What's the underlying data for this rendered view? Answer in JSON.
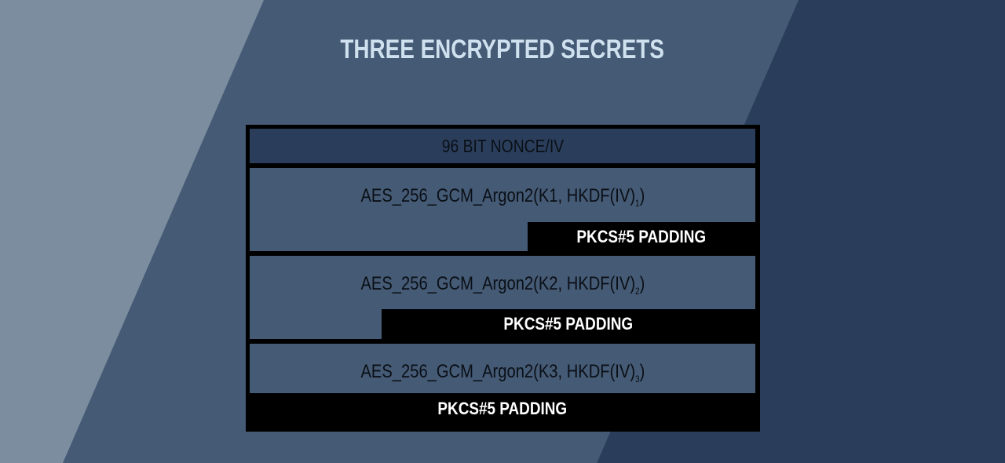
{
  "title": "THREE ENCRYPTED SECRETS",
  "nonce": {
    "label": "96 BIT NONCE/IV"
  },
  "secrets": [
    {
      "prefix": "AES_256_GCM_Argon2(K1, HKDF(IV)",
      "subscript": "1",
      "suffix": ")",
      "padding_label": "PKCS#5 PADDING"
    },
    {
      "prefix": "AES_256_GCM_Argon2(K2, HKDF(IV)",
      "subscript": "2",
      "suffix": ")",
      "padding_label": "PKCS#5 PADDING"
    },
    {
      "prefix": "AES_256_GCM_Argon2(K3, HKDF(IV)",
      "subscript": "3",
      "suffix": ")",
      "padding_label": "PKCS#5 PADDING"
    }
  ],
  "colors": {
    "bg_light": "#7c8d9f",
    "bg_mid": "#455a74",
    "bg_dark": "#2a3e5c",
    "title": "#cfe0ee",
    "frame": "#000000",
    "padding_text": "#ffffff"
  }
}
